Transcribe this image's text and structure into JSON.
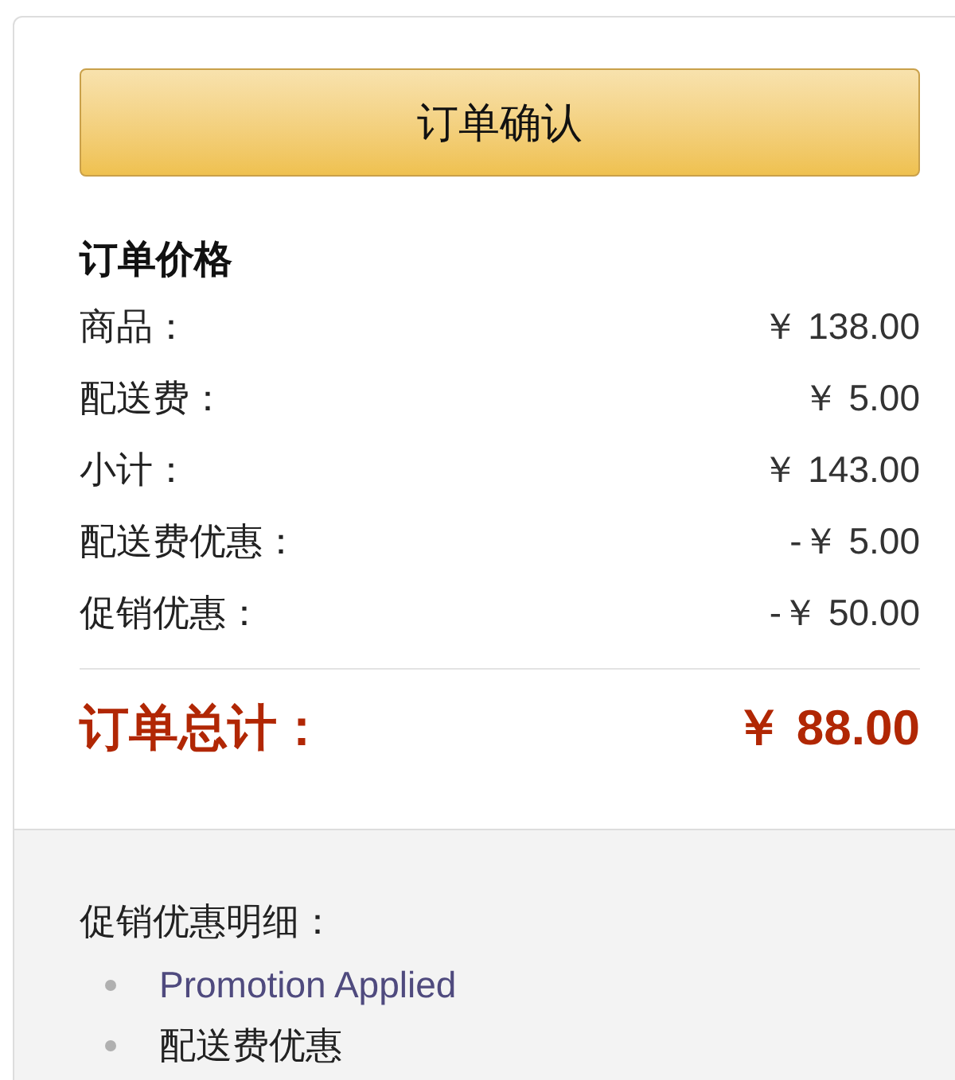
{
  "confirm_button": {
    "label": "订单确认"
  },
  "price_summary": {
    "title": "订单价格",
    "rows": [
      {
        "label": "商品：",
        "value": "￥ 138.00"
      },
      {
        "label": "配送费：",
        "value": "￥ 5.00"
      },
      {
        "label": "小计：",
        "value": "￥ 143.00"
      },
      {
        "label": "配送费优惠：",
        "value": "-￥ 5.00"
      },
      {
        "label": "促销优惠：",
        "value": "-￥ 50.00"
      }
    ],
    "total": {
      "label": "订单总计：",
      "value": "￥ 88.00"
    }
  },
  "promotion_details": {
    "title": "促销优惠明细：",
    "items": [
      {
        "kind": "link",
        "text": "Promotion Applied"
      },
      {
        "kind": "text",
        "text": "配送费优惠"
      }
    ]
  }
}
